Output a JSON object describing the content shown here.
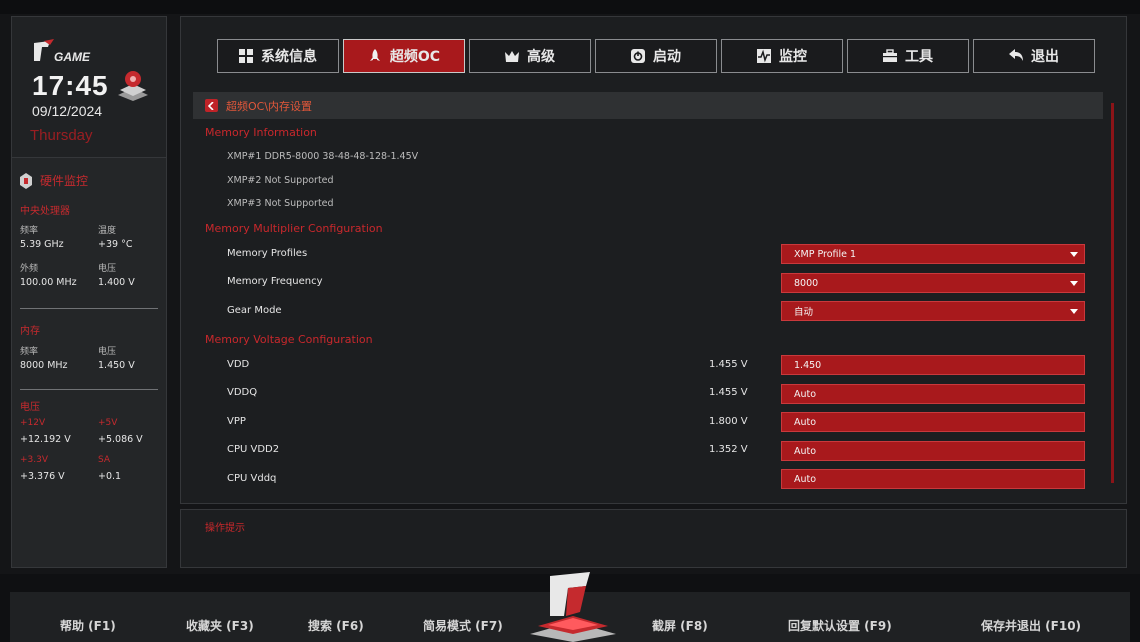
{
  "sidebar": {
    "time": "17:45",
    "date": "09/12/2024",
    "day": "Thursday",
    "monitor_title": "硬件监控",
    "cpu": {
      "title": "中央处理器",
      "freq_label": "频率",
      "freq": "5.39 GHz",
      "temp_label": "温度",
      "temp": "+39 °C",
      "bclk_label": "外频",
      "bclk": "100.00 MHz",
      "volt_label": "电压",
      "volt": "1.400 V"
    },
    "memory": {
      "title": "内存",
      "freq_label": "频率",
      "freq": "8000 MHz",
      "volt_label": "电压",
      "volt": "1.450 V"
    },
    "voltage": {
      "title": "电压",
      "v12_label": "+12V",
      "v12": "+12.192 V",
      "v5_label": "+5V",
      "v5": "+5.086 V",
      "v33_label": "+3.3V",
      "v33": "+3.376 V",
      "sa_label": "SA",
      "sa": "+0.1"
    }
  },
  "tabs": [
    {
      "label": "系统信息",
      "icon": "grid-icon"
    },
    {
      "label": "超频OC",
      "icon": "rocket-icon"
    },
    {
      "label": "高级",
      "icon": "crown-icon"
    },
    {
      "label": "启动",
      "icon": "power-icon"
    },
    {
      "label": "监控",
      "icon": "pulse-icon"
    },
    {
      "label": "工具",
      "icon": "toolbox-icon"
    },
    {
      "label": "退出",
      "icon": "back-arrow-icon"
    }
  ],
  "breadcrumb": "超频OC\\内存设置",
  "memory_info": {
    "title": "Memory Information",
    "xmp1": "XMP#1 DDR5-8000 38-48-48-128-1.45V",
    "xmp2": "XMP#2 Not Supported",
    "xmp3": "XMP#3 Not Supported"
  },
  "multiplier": {
    "title": "Memory Multiplier Configuration",
    "profiles_label": "Memory Profiles",
    "profiles_value": "XMP Profile 1",
    "freq_label": "Memory Frequency",
    "freq_value": "8000",
    "gear_label": "Gear Mode",
    "gear_value": "自动"
  },
  "voltage_cfg": {
    "title": "Memory Voltage Configuration",
    "vdd_label": "VDD",
    "vdd_current": "1.455 V",
    "vdd_value": "1.450",
    "vddq_label": "VDDQ",
    "vddq_current": "1.455 V",
    "vddq_value": "Auto",
    "vpp_label": "VPP",
    "vpp_current": "1.800 V",
    "vpp_value": "Auto",
    "cpuvdd2_label": "CPU VDD2",
    "cpuvdd2_current": "1.352 V",
    "cpuvdd2_value": "Auto",
    "cpuvddq_label": "CPU Vddq",
    "cpuvddq_value": "Auto"
  },
  "help_title": "操作提示",
  "footer": {
    "help": "帮助 (F1)",
    "favorites": "收藏夹 (F3)",
    "search": "搜索 (F6)",
    "easy": "简易模式 (F7)",
    "screenshot": "截屏 (F8)",
    "defaults": "回复默认设置 (F9)",
    "save_exit": "保存并退出 (F10)"
  },
  "colors": {
    "accent": "#a8191c",
    "accent_text": "#c8282c",
    "panel": "#1c1e20"
  }
}
